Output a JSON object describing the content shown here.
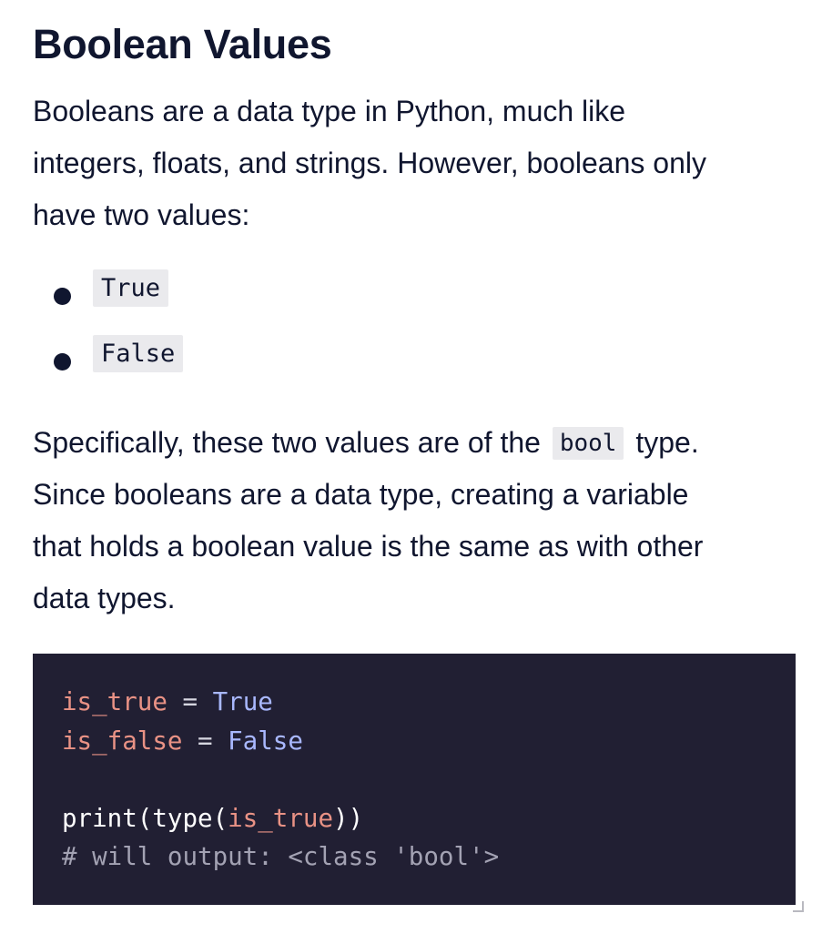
{
  "article": {
    "title": "Boolean Values",
    "intro_line1": "Booleans are a data type in Python, much like",
    "intro_line2": "integers, floats, and strings. However, booleans only",
    "intro_line3": "have two values:",
    "bullets": [
      {
        "code": "True"
      },
      {
        "code": "False"
      }
    ],
    "para2_line1_before": "Specifically, these two values are of the",
    "para2_line1_code": "bool",
    "para2_line1_after": "type.",
    "para2_line2": "Since booleans are a data type, creating a variable",
    "para2_line3": "that holds a boolean value is the same as with other",
    "para2_line4": "data types."
  },
  "code_block": {
    "lines": [
      {
        "var": "is_true",
        "op": " = ",
        "value": "True"
      },
      {
        "var": "is_false",
        "op": " = ",
        "value": "False"
      },
      {
        "fn_open": "print(type(",
        "arg": "is_true",
        "fn_close": "))"
      },
      {
        "comment": "# will output: <class 'bool'>"
      }
    ]
  },
  "colors": {
    "text": "#10162f",
    "inline_code_bg": "#eaeaed",
    "code_bg": "#211f33",
    "code_variable": "#e99285",
    "code_boolean": "#a9b8ff",
    "code_comment": "#a3a2b3"
  }
}
